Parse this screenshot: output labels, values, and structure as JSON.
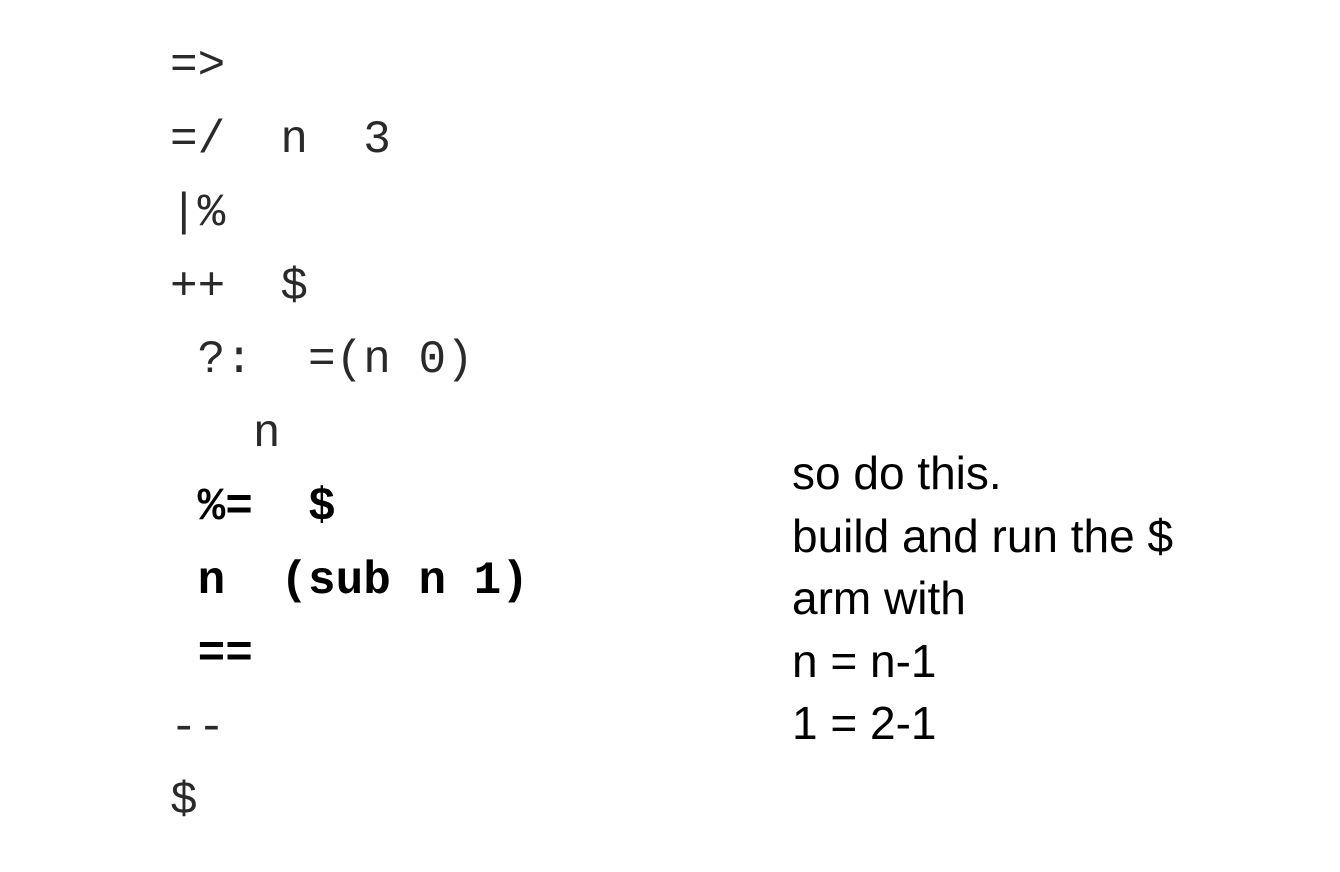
{
  "code": {
    "lines": [
      {
        "text": "=>",
        "weight": "light"
      },
      {
        "text": "=/  n  3",
        "weight": "light"
      },
      {
        "text": "|%",
        "weight": "light"
      },
      {
        "text": "++  $",
        "weight": "light"
      },
      {
        "text": " ?:  =(n 0)",
        "weight": "light"
      },
      {
        "text": "   n",
        "weight": "light"
      },
      {
        "text": " %=  $",
        "weight": "bold"
      },
      {
        "text": " n  (sub n 1)",
        "weight": "bold"
      },
      {
        "text": " ==",
        "weight": "bold"
      },
      {
        "text": "--",
        "weight": "light"
      },
      {
        "text": "$",
        "weight": "light"
      }
    ]
  },
  "note": {
    "lines": [
      "so do this.",
      "build and run the $",
      "arm with",
      "n = n-1",
      "1 = 2-1"
    ]
  }
}
